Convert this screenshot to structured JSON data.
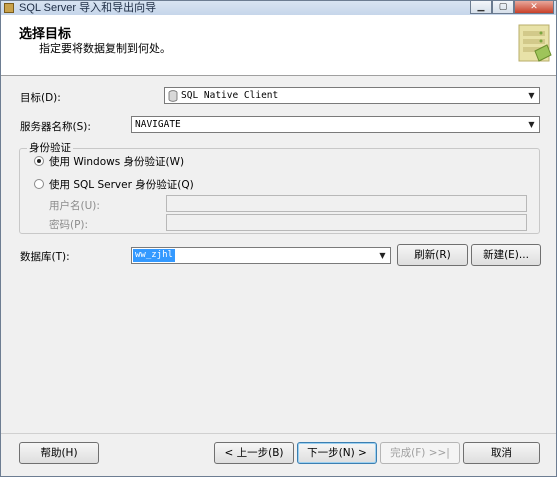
{
  "window": {
    "title": "SQL Server 导入和导出向导",
    "minimize_glyph": "▁",
    "maximize_glyph": "▢",
    "close_glyph": "✕"
  },
  "header": {
    "title": "选择目标",
    "subtitle": "指定要将数据复制到何处。"
  },
  "form": {
    "destination_label": "目标(D):",
    "destination_value": "SQL Native Client",
    "server_label": "服务器名称(S):",
    "server_value": "NAVIGATE",
    "auth_group_title": "身份验证",
    "windows_auth_label": "使用 Windows 身份验证(W)",
    "sql_auth_label": "使用 SQL Server 身份验证(Q)",
    "username_label": "用户名(U):",
    "username_value": "",
    "password_label": "密码(P):",
    "password_value": "",
    "database_label": "数据库(T):",
    "database_value": "ww_zjhl",
    "refresh_label": "刷新(R)",
    "new_label": "新建(E)..."
  },
  "footer": {
    "help_label": "帮助(H)",
    "back_label": "< 上一步(B)",
    "next_label": "下一步(N) >",
    "finish_label": "完成(F) >>|",
    "cancel_label": "取消"
  },
  "colors": {
    "selection": "#3399ff",
    "window_bg": "#f0f0f0",
    "header_bg": "#ffffff"
  }
}
